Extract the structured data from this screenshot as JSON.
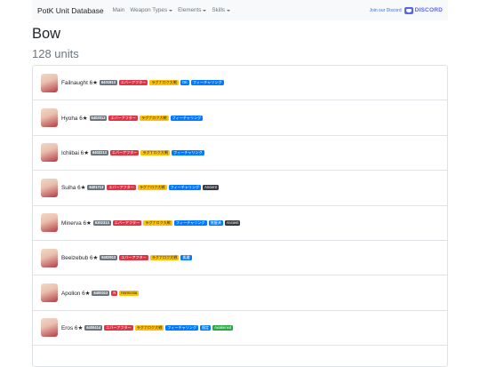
{
  "navbar": {
    "brand": "PotK Unit Database",
    "items": [
      {
        "label": "Main",
        "has_caret": false
      },
      {
        "label": "Weapon Types",
        "has_caret": true
      },
      {
        "label": "Elements",
        "has_caret": true
      },
      {
        "label": "Skills",
        "has_caret": true
      }
    ],
    "join_text": "Join our Discord",
    "discord_label": "DISCORD",
    "discord_color": "#5865f2"
  },
  "page": {
    "title": "Bow",
    "subtitle": "128 units"
  },
  "units": [
    {
      "name": "Failnaught 6★",
      "id": "6401913",
      "tags": [
        {
          "text": "エバーアフター",
          "color": "red"
        },
        {
          "text": "ラグナロク大戦",
          "color": "yellow"
        },
        {
          "text": "OK",
          "color": "blue"
        },
        {
          "text": "フィーチャリング",
          "color": "blue"
        }
      ]
    },
    {
      "name": "Hyoha 6★",
      "id": "6402013",
      "tags": [
        {
          "text": "エバーアフター",
          "color": "red"
        },
        {
          "text": "ラグナロク大戦",
          "color": "yellow"
        },
        {
          "text": "フィーチャリング",
          "color": "blue"
        }
      ]
    },
    {
      "name": "Ichiibai 6★",
      "id": "6402213",
      "tags": [
        {
          "text": "エバーアフター",
          "color": "red"
        },
        {
          "text": "ラグナロク大戦",
          "color": "yellow"
        },
        {
          "text": "フィーチャリング",
          "color": "blue"
        }
      ]
    },
    {
      "name": "Suiha 6★",
      "id": "6401713",
      "tags": [
        {
          "text": "エバーアフター",
          "color": "red"
        },
        {
          "text": "ラグナロク大戦",
          "color": "yellow"
        },
        {
          "text": "フィーチャリング",
          "color": "blue"
        },
        {
          "text": "Ancient",
          "color": "dark"
        }
      ]
    },
    {
      "name": "Minerva 6★",
      "id": "6302313",
      "tags": [
        {
          "text": "エバーアフター",
          "color": "red"
        },
        {
          "text": "ラグナロク大戦",
          "color": "yellow"
        },
        {
          "text": "フィーチャリング",
          "color": "blue"
        },
        {
          "text": "覚醒済",
          "color": "blue"
        },
        {
          "text": "Ancient",
          "color": "dark"
        }
      ]
    },
    {
      "name": "Beelzebub 6★",
      "id": "6402913",
      "tags": [
        {
          "text": "エバーアフター",
          "color": "red"
        },
        {
          "text": "ラグナロク大戦",
          "color": "yellow"
        },
        {
          "text": "悪魔",
          "color": "blue"
        }
      ]
    },
    {
      "name": "Apollon 6★",
      "id": "6400313",
      "tags": [
        {
          "text": "N",
          "color": "red"
        },
        {
          "text": "Harmonia",
          "color": "yellow"
        }
      ]
    },
    {
      "name": "Eros 6★",
      "id": "6400414",
      "tags": [
        {
          "text": "エバーアフター",
          "color": "red"
        },
        {
          "text": "ラグナロク大戦",
          "color": "yellow"
        },
        {
          "text": "フィーチャリング",
          "color": "blue"
        },
        {
          "text": "限定",
          "color": "blue"
        },
        {
          "text": "Awakened",
          "color": "green"
        }
      ]
    }
  ]
}
